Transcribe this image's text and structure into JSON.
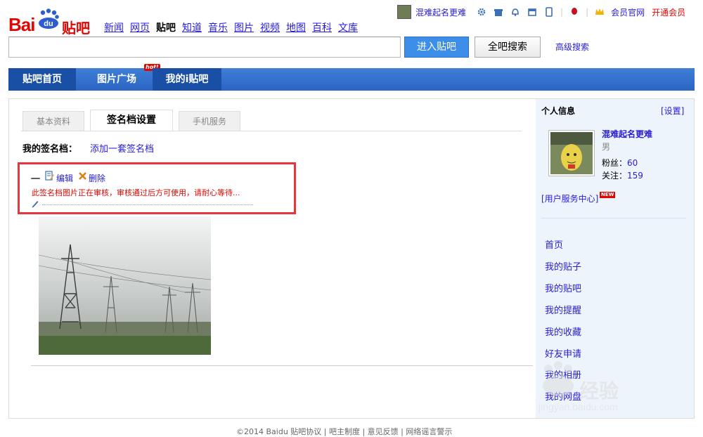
{
  "logo": {
    "text_left": "Bai",
    "text_mid": "du",
    "text_right": "贴吧"
  },
  "top_nav": [
    "新闻",
    "网页",
    "贴吧",
    "知道",
    "音乐",
    "图片",
    "视频",
    "地图",
    "百科",
    "文库"
  ],
  "top_nav_current": "贴吧",
  "user_bar": {
    "username": "混难起名更难",
    "vip_label": "会员官网",
    "open_vip_label": "开通会员"
  },
  "search": {
    "value": "",
    "enter_button": "进入贴吧",
    "all_button": "全吧搜索",
    "advanced_link": "高级搜索"
  },
  "nav": {
    "home": "贴吧首页",
    "pictures": "图片广场",
    "hot_badge": "hot!",
    "my_tieba": "我的i贴吧"
  },
  "tabs": {
    "basic": "基本资料",
    "signature": "签名档设置",
    "mobile": "手机服务"
  },
  "signature": {
    "label": "我的签名档：",
    "add_link": "添加一套签名档",
    "dash": "一",
    "edit": "编辑",
    "delete": "删除",
    "review_message": "此签名档图片正在审核，审核通过后方可使用，请耐心等待..."
  },
  "profile": {
    "title": "个人信息",
    "settings": "[设置]",
    "name": "混难起名更难",
    "gender": "男",
    "fans_label": "粉丝：",
    "fans": "60",
    "follow_label": "关注：",
    "follow": "159",
    "service_link": "[用户服务中心]",
    "new_badge": "NEW"
  },
  "side_menu": [
    "首页",
    "我的贴子",
    "我的贴吧",
    "我的提醒",
    "我的收藏",
    "好友申请",
    "我的相册",
    "我的网盘"
  ],
  "watermark": {
    "text": "经验",
    "url": "jingyan.baidu.com"
  },
  "footer": "©2014 Baidu 贴吧协议 | 吧主制度 | 意见反馈 | 网络谣言警示",
  "colors": {
    "accent_blue": "#3c8ee8",
    "nav_blue": "#2a64c4",
    "link": "#261cdc",
    "alert_red": "#e10602",
    "highlight_box": "#e8343c"
  }
}
